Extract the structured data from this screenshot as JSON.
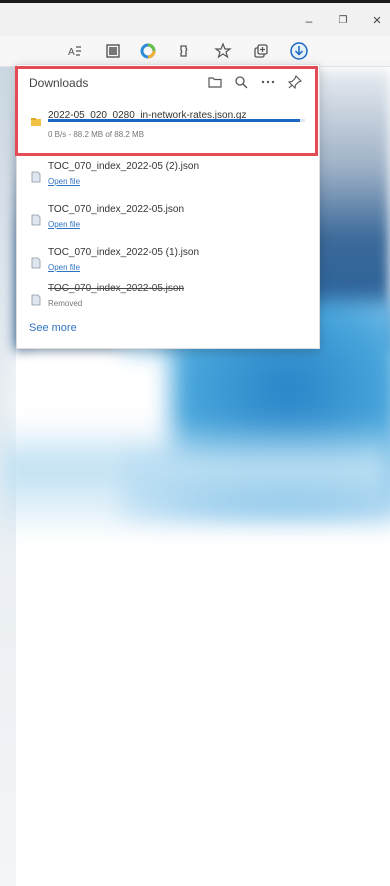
{
  "window": {
    "minimize_glyph": "–",
    "restore_glyph": "❐",
    "close_glyph": "×"
  },
  "toolbar": {
    "icons": [
      {
        "name": "read-aloud-icon",
        "glyph": "Aa"
      },
      {
        "name": "immersive-reader-icon",
        "glyph": "▤"
      },
      {
        "name": "browser-essentials-icon",
        "glyph": "●"
      },
      {
        "name": "extensions-icon",
        "glyph": "⬡"
      },
      {
        "name": "favorites-icon",
        "glyph": "☆"
      },
      {
        "name": "collections-icon",
        "glyph": "⧉"
      },
      {
        "name": "downloads-icon",
        "glyph": "⤓"
      }
    ]
  },
  "downloads": {
    "title": "Downloads",
    "see_more": "See more",
    "items": [
      {
        "name": "2022-05_020_0280_in-network-rates.json.gz",
        "status": "0 B/s - 88.2 MB of 88.2 MB",
        "progress_fraction": 0.98,
        "active": true
      },
      {
        "name": "TOC_070_index_2022-05 (2).json",
        "status": "Open file"
      },
      {
        "name": "TOC_070_index_2022-05.json",
        "status": "Open file"
      },
      {
        "name": "TOC_070_index_2022-05 (1).json",
        "status": "Open file"
      },
      {
        "name": "TOC_070_index_2022-05.json",
        "status": "Removed",
        "removed": true
      }
    ]
  },
  "colors": {
    "accent": "#1a68c2",
    "highlight": "#e44b54",
    "link": "#2f74c0"
  }
}
